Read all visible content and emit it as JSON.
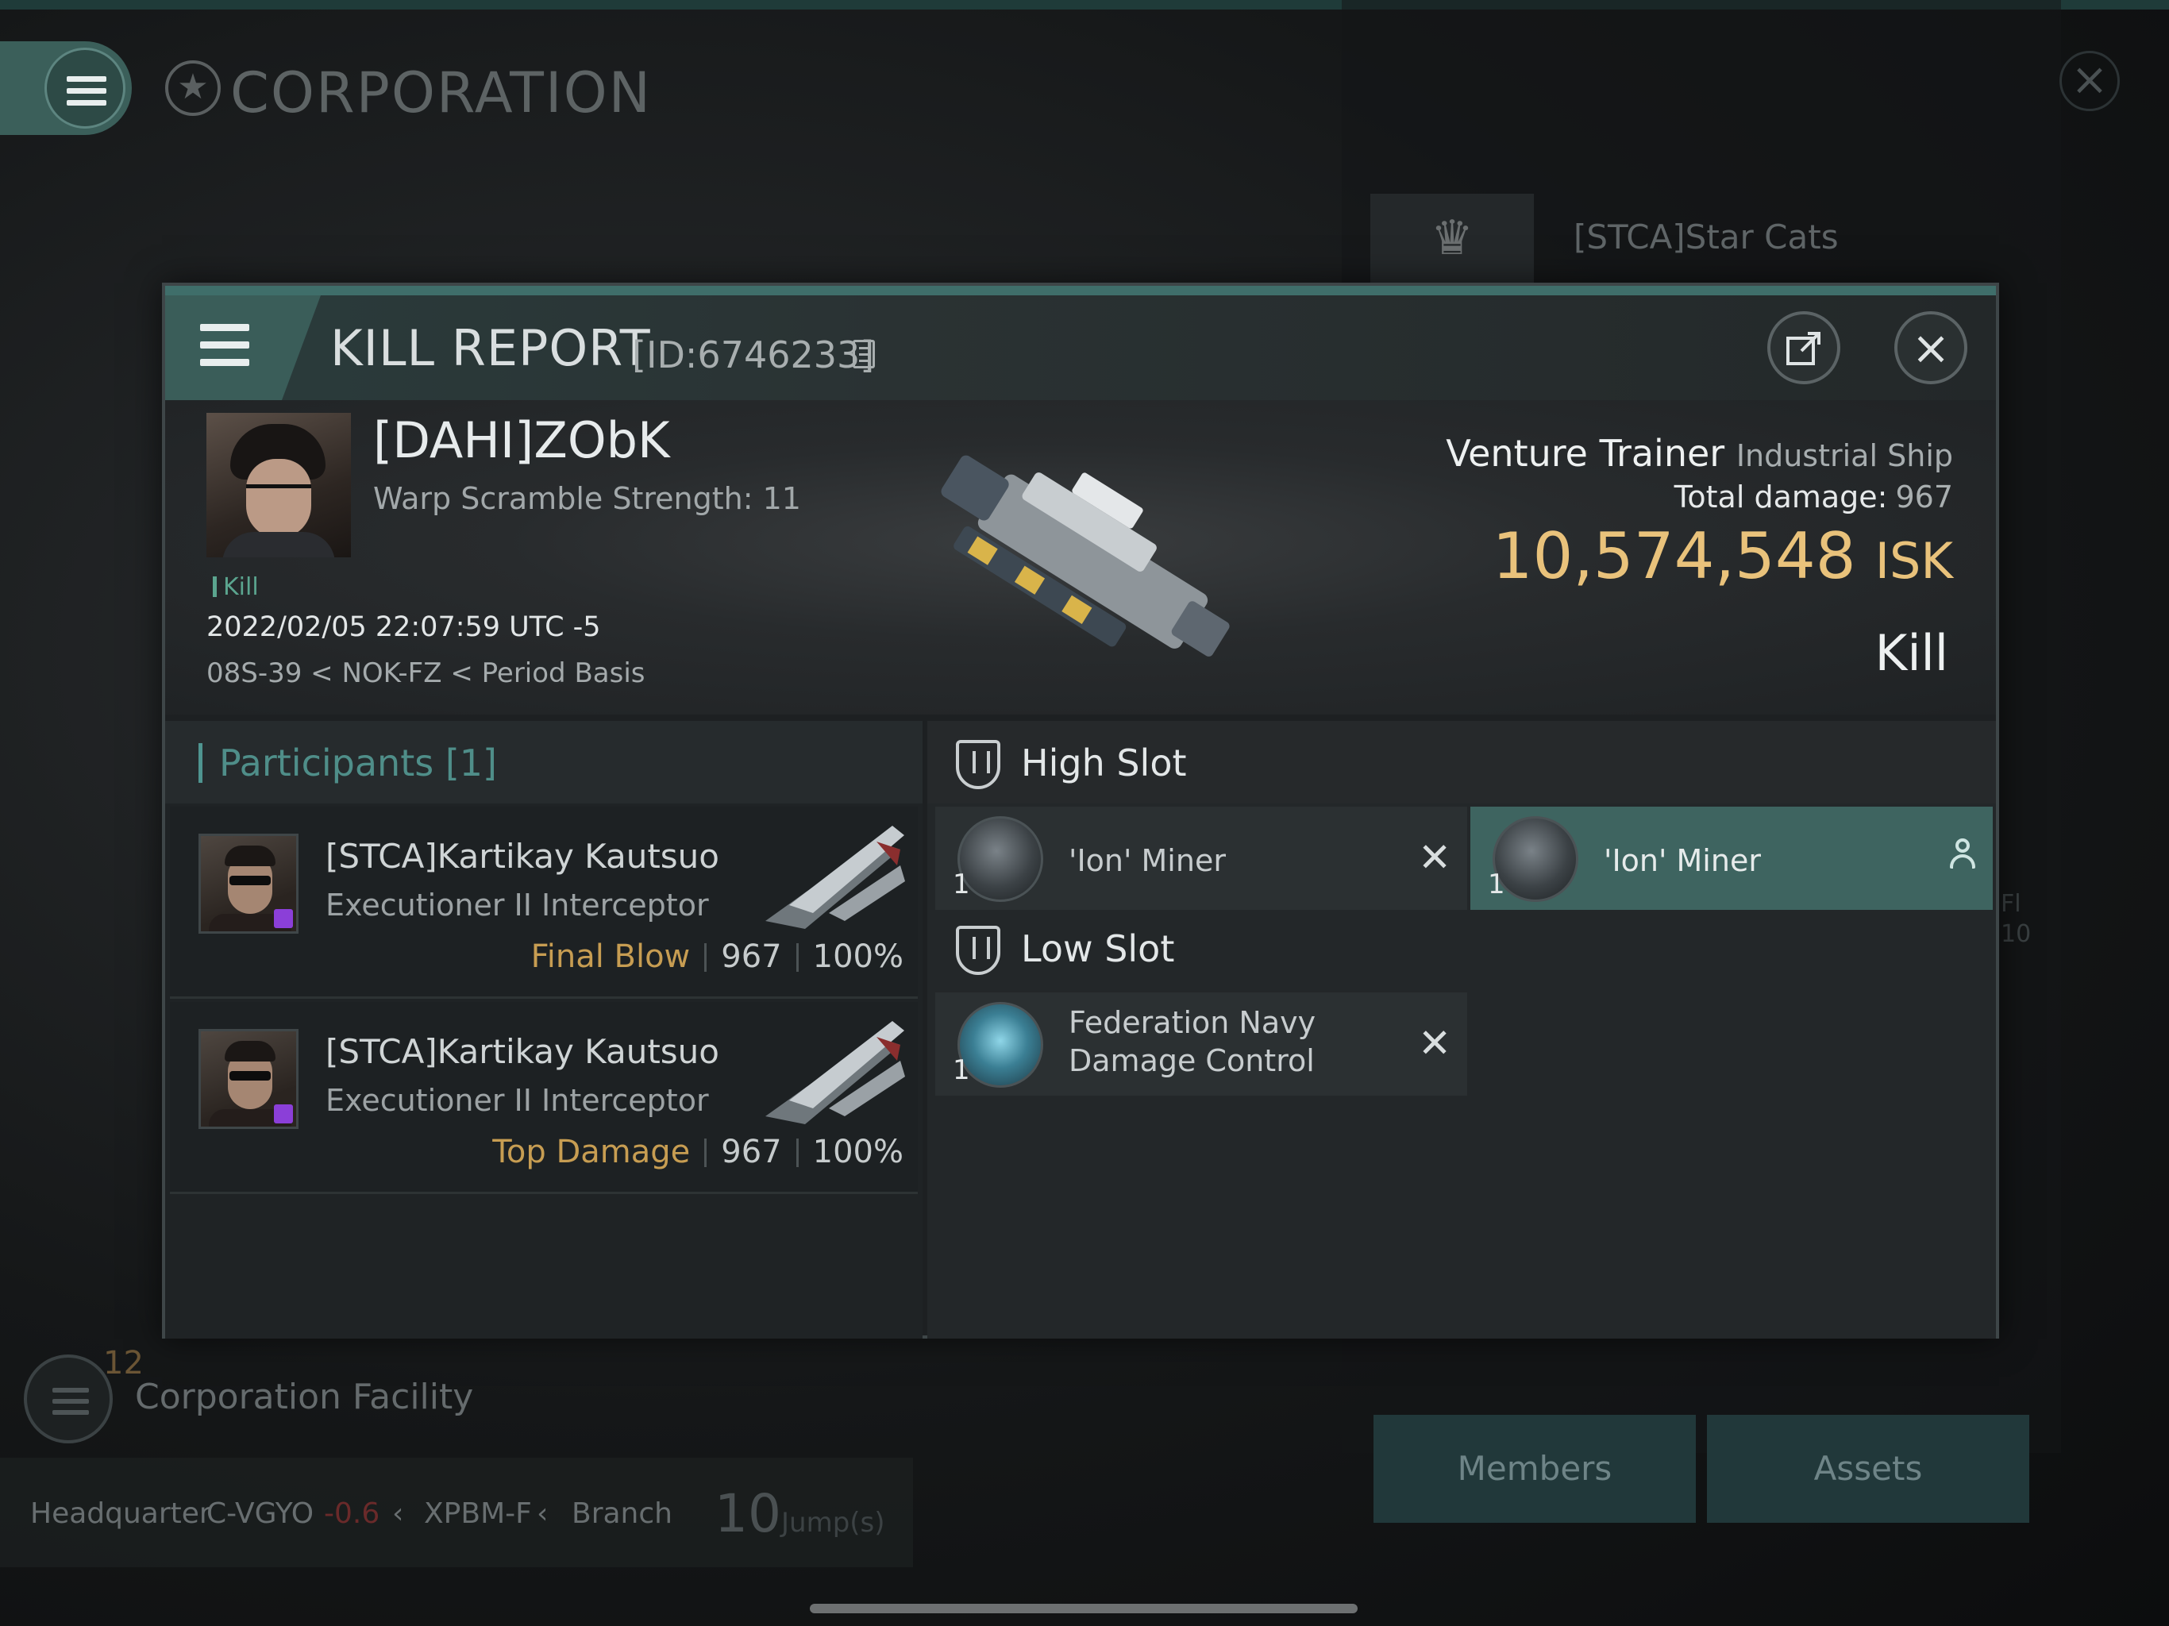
{
  "background": {
    "title": "CORPORATION",
    "corp_name": "[STCA]Star Cats",
    "ghost_text_1": "Fl",
    "ghost_text_2": "10",
    "facility_count": "12",
    "facility_label": "Corporation Facility",
    "hq_label": "Headquarter",
    "hq_system": "C-VGYO",
    "hq_security": "-0.6",
    "hq_region": "XPBM-F",
    "hq_type": "Branch",
    "jumps_value": "10",
    "jumps_label": "Jump(s)",
    "members_button": "Members",
    "assets_button": "Assets"
  },
  "kill_report": {
    "title": "KILL REPORT",
    "id_label": "[ID:6746233]",
    "victim": {
      "name": "[DAHI]ZObK",
      "warp_scramble": "Warp Scramble Strength: 11",
      "tag": "Kill",
      "datetime": "2022/02/05 22:07:59 UTC -5",
      "location": "08S-39 < NOK-FZ < Period Basis"
    },
    "ship": {
      "name": "Venture Trainer",
      "class": "Industrial Ship",
      "total_damage_label": "Total damage:",
      "total_damage_value": "967",
      "isk_value": "10,574,548",
      "isk_unit": "ISK",
      "result": "Kill"
    },
    "participants": {
      "header": "Participants [1]",
      "rows": [
        {
          "name": "[STCA]Kartikay Kautsuo",
          "ship": "Executioner II Interceptor",
          "tag": "Final Blow",
          "damage": "967",
          "percent": "100%"
        },
        {
          "name": "[STCA]Kartikay Kautsuo",
          "ship": "Executioner II Interceptor",
          "tag": "Top Damage",
          "damage": "967",
          "percent": "100%"
        }
      ]
    },
    "fitting": {
      "high_slot_label": "High Slot",
      "low_slot_label": "Low Slot",
      "high_modules": [
        {
          "qty": "1",
          "name": "'Ion' Miner",
          "status": "destroyed",
          "status_glyph": "✕"
        },
        {
          "qty": "1",
          "name": "'Ion' Miner",
          "status": "dropped"
        }
      ],
      "low_modules": [
        {
          "qty": "1",
          "name_line1": "Federation Navy",
          "name_line2": "Damage Control",
          "status": "destroyed",
          "status_glyph": "✕"
        }
      ]
    }
  },
  "colors": {
    "accent_teal": "#3e6460",
    "isk_gold": "#e9c27b",
    "final_blow": "#c79d52",
    "kill_green": "#5ba58f"
  }
}
